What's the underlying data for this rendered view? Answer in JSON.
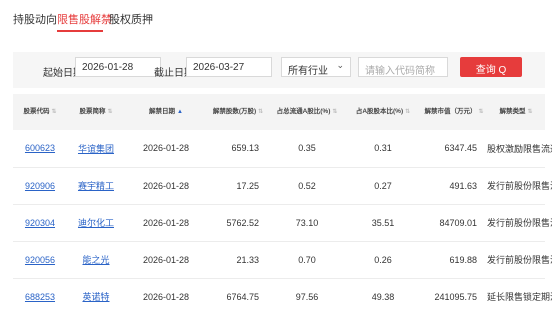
{
  "tabs": [
    {
      "label": "持股动向"
    },
    {
      "label": "限售股解禁"
    },
    {
      "label": "股权质押"
    }
  ],
  "filter": {
    "start_label": "起始日期：",
    "start_value": "2026-01-28",
    "end_label": "截止日期：",
    "end_value": "2026-03-27",
    "industry_value": "所有行业",
    "search_placeholder": "请输入代码简称",
    "query_label": "查询 Q"
  },
  "table": {
    "headers": [
      "股票代码",
      "股票简称",
      "解禁日期",
      "解禁股数(万股)",
      "占总流通A股比(%)",
      "占A股股本比(%)",
      "解禁市值（万元）",
      "解禁类型"
    ],
    "rows": [
      {
        "code": "600623",
        "name": "华谊集团",
        "date": "2026-01-28",
        "shares": "659.13",
        "float_pct": "0.35",
        "capital_pct": "0.31",
        "value": "6347.45",
        "type": "股权激励限售流通"
      },
      {
        "code": "920906",
        "name": "赛宇精工",
        "date": "2026-01-28",
        "shares": "17.25",
        "float_pct": "0.52",
        "capital_pct": "0.27",
        "value": "491.63",
        "type": "发行前股份限售流通"
      },
      {
        "code": "920304",
        "name": "迪尔化工",
        "date": "2026-01-28",
        "shares": "5762.52",
        "float_pct": "73.10",
        "capital_pct": "35.51",
        "value": "84709.01",
        "type": "发行前股份限售流通"
      },
      {
        "code": "920056",
        "name": "能之光",
        "date": "2026-01-28",
        "shares": "21.33",
        "float_pct": "0.70",
        "capital_pct": "0.26",
        "value": "619.88",
        "type": "发行前股份限售流通"
      },
      {
        "code": "688253",
        "name": "英诺特",
        "date": "2026-01-28",
        "shares": "6764.75",
        "float_pct": "97.56",
        "capital_pct": "49.38",
        "value": "241095.75",
        "type": "延长限售锁定期流通"
      }
    ]
  }
}
